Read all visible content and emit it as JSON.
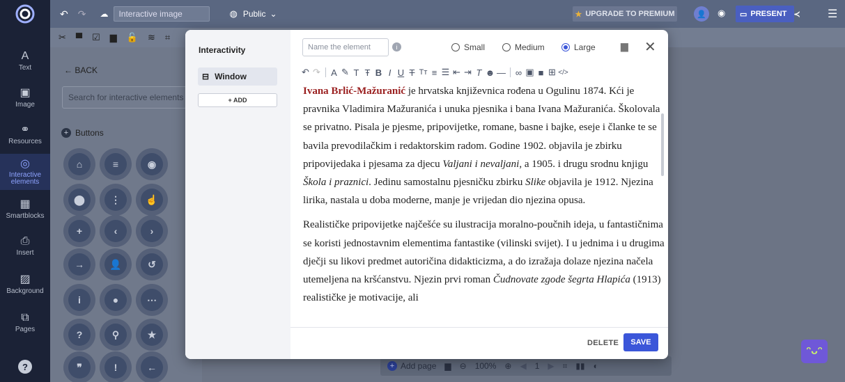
{
  "topbar": {
    "title_value": "Interactive image",
    "visibility": "Public",
    "upgrade": "UPGRADE TO PREMIUM",
    "present": "PRESENT"
  },
  "rail": [
    {
      "label": "Text",
      "icon": "text-icon"
    },
    {
      "label": "Image",
      "icon": "image-icon"
    },
    {
      "label": "Resources",
      "icon": "resources-icon"
    },
    {
      "label": "Interactive elements",
      "icon": "interactive-icon",
      "active": true
    },
    {
      "label": "Smartblocks",
      "icon": "smartblocks-icon"
    },
    {
      "label": "Insert",
      "icon": "insert-icon"
    },
    {
      "label": "Background",
      "icon": "background-icon"
    },
    {
      "label": "Pages",
      "icon": "pages-icon"
    }
  ],
  "leftpanel": {
    "back": "BACK",
    "search_placeholder": "Search for interactive elements",
    "section": "Buttons"
  },
  "modal": {
    "sidebar_title": "Interactivity",
    "window_label": "Window",
    "add_label": "+ ADD",
    "name_placeholder": "Name the element",
    "sizes": [
      "Small",
      "Medium",
      "Large"
    ],
    "selected_size": "Large",
    "delete": "DELETE",
    "save": "SAVE"
  },
  "content": {
    "p1_name": "Ivana Brlić-Mažuranić",
    "p1_a": " je hrvatska književnica rođena u Ogulinu 1874. Kći je pravnika Vladimira Mažuranića i unuka pjesnika i bana Ivana Mažuranića. Školovala se privatno. Pisala je pjesme, pripovijetke, romane, basne i bajke, eseje i članke te se bavila prevodilačkim i redaktorskim radom. Godine 1902. objavila je zbirku pripovijedaka i pjesama za djecu ",
    "p1_i1": "Valjani i nevaljani",
    "p1_b": ", a 1905. i drugu srodnu knjigu ",
    "p1_i2": "Škola i praznici",
    "p1_c": ". Jedinu samostalnu pjesničku zbirku ",
    "p1_i3": "Slike",
    "p1_d": " objavila je 1912. Njezina lirika, nastala u doba moderne, manje je vrijedan dio njezina opusa.",
    "p2_a": "Realističke pripovijetke najčešće su ilustracija moralno-poučnih ideja, u fantastičnima se koristi jednostavnim elementima fantastike (vilinski svijet). I u jednima i u drugima dječji su likovi predmet autoričina didakticizma, a do izražaja dolaze njezina načela utemeljena na kršćanstvu. Njezin prvi roman ",
    "p2_i": "Čudnovate zgode šegrta Hlapića",
    "p2_b": " (1913) realističke je motivacije, ali"
  },
  "bottom": {
    "add_page": "Add page",
    "zoom": "100%",
    "page": "1"
  }
}
